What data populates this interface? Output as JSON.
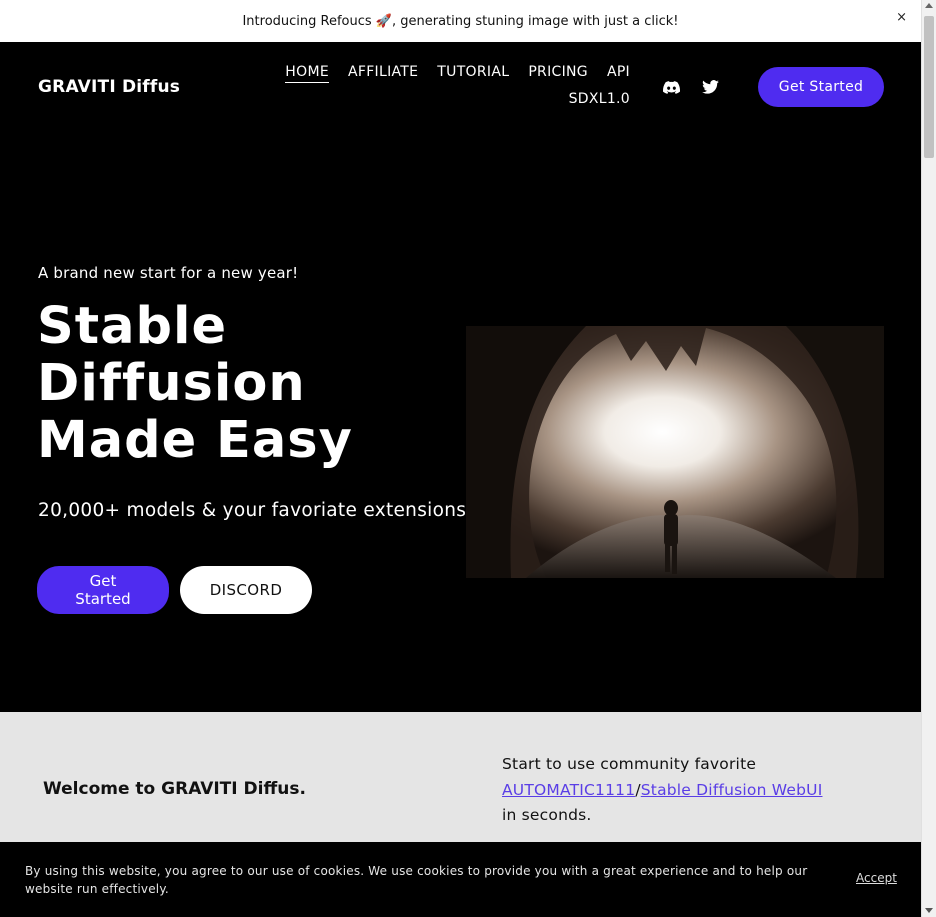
{
  "announcement": {
    "text": "Introducing Refoucs 🚀, generating stuning image with just a click!",
    "close": "×"
  },
  "header": {
    "brand": "GRAVITI Diffus",
    "nav": [
      "HOME",
      "AFFILIATE",
      "TUTORIAL",
      "PRICING",
      "API",
      "SDXL1.0"
    ],
    "active_nav": "HOME",
    "social_icons": [
      "discord-icon",
      "twitter-icon"
    ],
    "cta": "Get Started"
  },
  "hero": {
    "subtitle": "A brand new start for a new year!",
    "title_lines": [
      "Stable",
      "Diffusion",
      "Made Easy"
    ],
    "description": "20,000+ models & your favoriate extensions",
    "primary_button": "Get Started",
    "secondary_button": "DISCORD"
  },
  "welcome": {
    "title": "Welcome to GRAVITI Diffus.",
    "text_prefix": "Start to use community favorite",
    "link1": "AUTOMATIC1111",
    "separator": "/",
    "link2": "Stable Diffusion WebUI",
    "text_suffix": "in seconds."
  },
  "cookie": {
    "text": "By using this website, you agree to our use of cookies. We use cookies to provide you with a great experience and to help our website run effectively.",
    "accept": "Accept"
  },
  "colors": {
    "accent": "#4f2cf0",
    "link": "#5a3ee6",
    "background": "#000000",
    "section_bg": "#e5e5e5"
  }
}
